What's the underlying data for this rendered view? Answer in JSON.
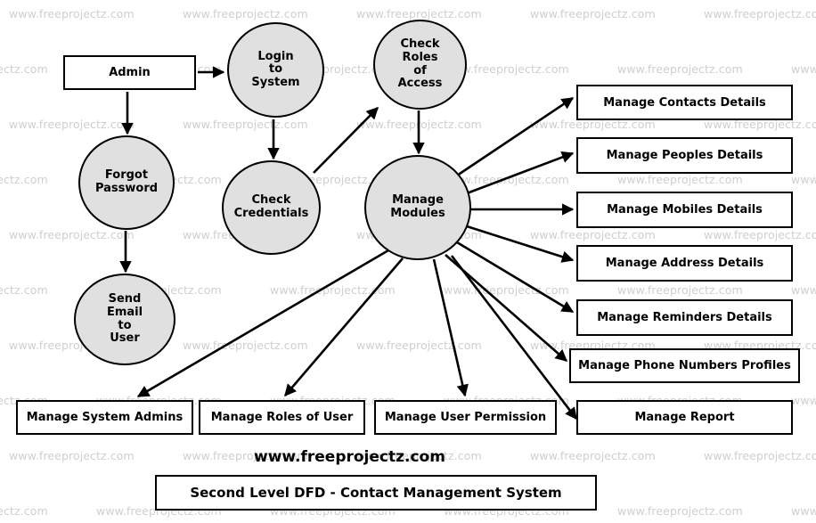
{
  "diagram": {
    "title": "Second Level DFD - Contact Management System",
    "brand": "www.freeprojectz.com",
    "watermark_text": "www.freeprojectz.com",
    "colors": {
      "process_fill": "#e0e0e0",
      "entity_fill": "#ffffff",
      "stroke": "#000000",
      "watermark": "#cfcfcf",
      "background": "#ffffff"
    }
  },
  "nodes": {
    "admin": {
      "label": "Admin",
      "type": "external-entity"
    },
    "login_to_system": {
      "label": "Login to System",
      "lines": [
        "Login",
        "to",
        "System"
      ],
      "type": "process"
    },
    "check_roles_of_access": {
      "label": "Check Roles of Access",
      "lines": [
        "Check",
        "Roles",
        "of",
        "Access"
      ],
      "type": "process"
    },
    "forgot_password": {
      "label": "Forgot Password",
      "lines": [
        "Forgot",
        "Password"
      ],
      "type": "process"
    },
    "check_credentials": {
      "label": "Check Credentials",
      "lines": [
        "Check",
        "Credentials"
      ],
      "type": "process"
    },
    "manage_modules": {
      "label": "Manage Modules",
      "lines": [
        "Manage",
        "Modules"
      ],
      "type": "process"
    },
    "send_email_to_user": {
      "label": "Send Email to User",
      "lines": [
        "Send",
        "Email",
        "to",
        "User"
      ],
      "type": "process"
    }
  },
  "right_boxes": [
    {
      "label": "Manage Contacts Details"
    },
    {
      "label": "Manage Peoples Details"
    },
    {
      "label": "Manage Mobiles Details"
    },
    {
      "label": "Manage Address Details"
    },
    {
      "label": "Manage Reminders Details"
    },
    {
      "label": "Manage Phone Numbers Profiles"
    }
  ],
  "bottom_boxes": [
    {
      "label": "Manage System Admins"
    },
    {
      "label": "Manage Roles of User"
    },
    {
      "label": "Manage User Permission"
    },
    {
      "label": "Manage Report"
    }
  ],
  "edges": [
    {
      "from": "admin",
      "to": "login_to_system"
    },
    {
      "from": "admin",
      "to": "forgot_password"
    },
    {
      "from": "login_to_system",
      "to": "check_credentials"
    },
    {
      "from": "forgot_password",
      "to": "send_email_to_user"
    },
    {
      "from": "check_credentials",
      "to": "check_roles_of_access"
    },
    {
      "from": "check_roles_of_access",
      "to": "manage_modules"
    },
    {
      "from": "manage_modules",
      "to": "manage_contacts_details"
    },
    {
      "from": "manage_modules",
      "to": "manage_peoples_details"
    },
    {
      "from": "manage_modules",
      "to": "manage_mobiles_details"
    },
    {
      "from": "manage_modules",
      "to": "manage_address_details"
    },
    {
      "from": "manage_modules",
      "to": "manage_reminders_details"
    },
    {
      "from": "manage_modules",
      "to": "manage_phone_numbers_profiles"
    },
    {
      "from": "manage_modules",
      "to": "manage_system_admins"
    },
    {
      "from": "manage_modules",
      "to": "manage_roles_of_user"
    },
    {
      "from": "manage_modules",
      "to": "manage_user_permission"
    },
    {
      "from": "manage_modules",
      "to": "manage_report"
    }
  ]
}
